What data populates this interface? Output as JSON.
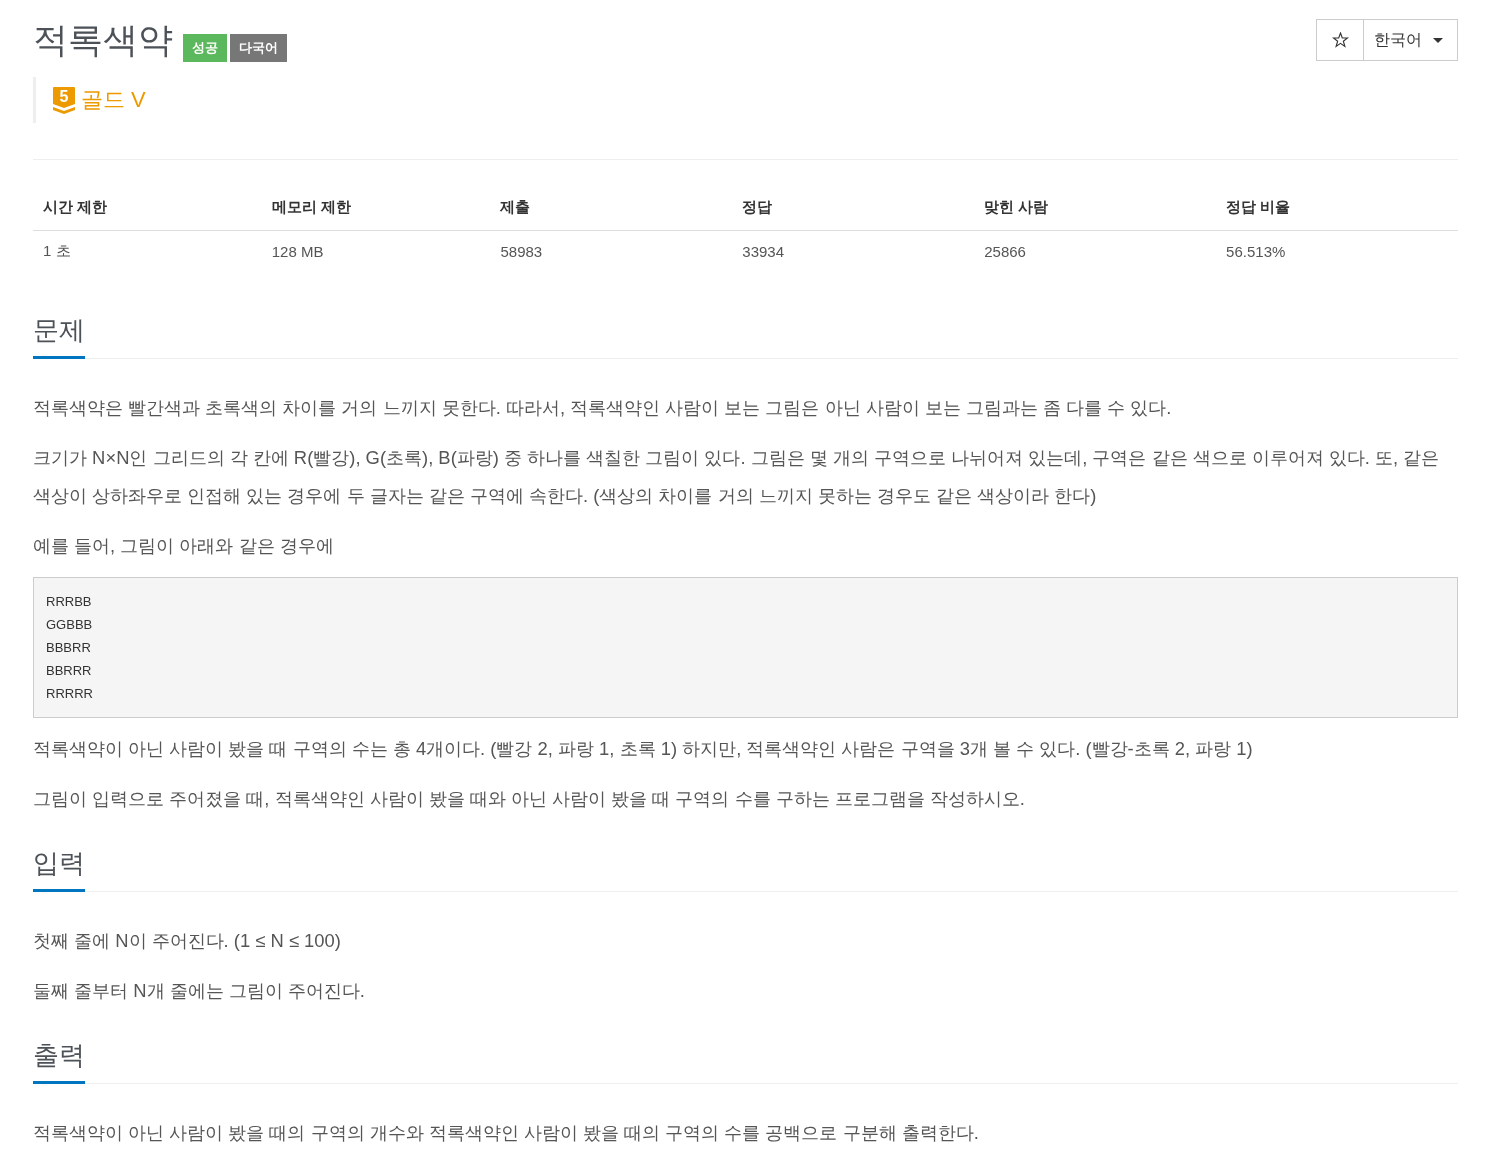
{
  "problem": {
    "title": "적록색약",
    "tags": [
      {
        "label": "성공",
        "kind": "success"
      },
      {
        "label": "다국어",
        "kind": "multilang"
      }
    ],
    "tier": {
      "kind": "gold",
      "level": "5",
      "label": "골드 V"
    }
  },
  "toolbar": {
    "language": "한국어"
  },
  "info_table": {
    "columns": [
      "시간 제한",
      "메모리 제한",
      "제출",
      "정답",
      "맞힌 사람",
      "정답 비율"
    ],
    "rows": [
      [
        "1 초",
        "128 MB",
        "58983",
        "33934",
        "25866",
        "56.513%"
      ]
    ]
  },
  "sections": [
    {
      "title": "문제",
      "blocks": [
        {
          "kind": "paragraph",
          "text": "적록색약은 빨간색과 초록색의 차이를 거의 느끼지 못한다. 따라서, 적록색약인 사람이 보는 그림은 아닌 사람이 보는 그림과는 좀 다를 수 있다."
        },
        {
          "kind": "paragraph",
          "text": "크기가 N×N인 그리드의 각 칸에 R(빨강), G(초록), B(파랑) 중 하나를 색칠한 그림이 있다. 그림은 몇 개의 구역으로 나뉘어져 있는데, 구역은 같은 색으로 이루어져 있다. 또, 같은 색상이 상하좌우로 인접해 있는 경우에 두 글자는 같은 구역에 속한다. (색상의 차이를 거의 느끼지 못하는 경우도 같은 색상이라 한다)"
        },
        {
          "kind": "paragraph",
          "text": "예를 들어, 그림이 아래와 같은 경우에"
        },
        {
          "kind": "code",
          "lines": [
            "RRRBB",
            "GGBBB",
            "BBBRR",
            "BBRRR",
            "RRRRR"
          ]
        },
        {
          "kind": "paragraph",
          "text": "적록색약이 아닌 사람이 봤을 때 구역의 수는 총 4개이다. (빨강 2, 파랑 1, 초록 1) 하지만, 적록색약인 사람은 구역을 3개 볼 수 있다. (빨강-초록 2, 파랑 1)"
        },
        {
          "kind": "paragraph",
          "text": "그림이 입력으로 주어졌을 때, 적록색약인 사람이 봤을 때와 아닌 사람이 봤을 때 구역의 수를 구하는 프로그램을 작성하시오."
        }
      ]
    },
    {
      "title": "입력",
      "blocks": [
        {
          "kind": "paragraph",
          "text": "첫째 줄에 N이 주어진다. (1 ≤ N ≤ 100)"
        },
        {
          "kind": "paragraph",
          "text": "둘째 줄부터 N개 줄에는 그림이 주어진다."
        }
      ]
    },
    {
      "title": "출력",
      "blocks": [
        {
          "kind": "paragraph",
          "text": "적록색약이 아닌 사람이 봤을 때의 구역의 개수와 적록색약인 사람이 봤을 때의 구역의 수를 공백으로 구분해 출력한다."
        }
      ]
    }
  ]
}
